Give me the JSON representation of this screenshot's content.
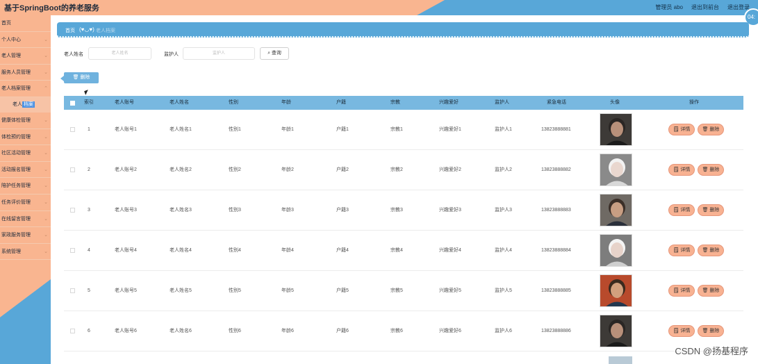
{
  "header": {
    "title": "基于SpringBoot的养老服务",
    "user_label": "管理员 abo",
    "to_front": "退出到前台",
    "logout": "退出登录",
    "clock": "04:"
  },
  "sidebar": {
    "items": [
      {
        "label": "首页",
        "chev": ""
      },
      {
        "label": "个人中心",
        "chev": "⌄"
      },
      {
        "label": "老人管理",
        "chev": "⌄"
      },
      {
        "label": "服务人员管理",
        "chev": "⌄"
      },
      {
        "label": "老人档案管理",
        "chev": "⌃"
      }
    ],
    "sub_label_a": "老人",
    "sub_label_b": "档案",
    "items2": [
      {
        "label": "健康体检管理",
        "chev": "⌄"
      },
      {
        "label": "体检预约管理",
        "chev": "⌄"
      },
      {
        "label": "社区活动管理",
        "chev": "⌄"
      },
      {
        "label": "活动报名管理",
        "chev": "⌄"
      },
      {
        "label": "陪护任务管理",
        "chev": "⌄"
      },
      {
        "label": "任务评价管理",
        "chev": "⌄"
      },
      {
        "label": "在线留言管理",
        "chev": "⌄"
      },
      {
        "label": "家政服务管理",
        "chev": "⌄"
      },
      {
        "label": "系统管理",
        "chev": "⌄"
      }
    ]
  },
  "breadcrumb": {
    "home": "首页",
    "separator": "(♥◡♥)",
    "current": "老人档案"
  },
  "search": {
    "name_label": "老人姓名",
    "name_placeholder": "老人姓名",
    "guardian_label": "监护人",
    "guardian_placeholder": "监护人",
    "button": "⌕ 查询"
  },
  "actions": {
    "delete": "🗑 删除"
  },
  "table": {
    "headers": [
      "索引",
      "老人账号",
      "老人姓名",
      "性别",
      "年龄",
      "户籍",
      "宗教",
      "兴趣爱好",
      "监护人",
      "紧急电话",
      "头像",
      "操作"
    ],
    "detail_label": "🗒 详情",
    "delete_label": "🗑 删除",
    "rows": [
      {
        "index": "1",
        "account": "老人账号1",
        "name": "老人姓名1",
        "gender": "性别1",
        "age": "年龄1",
        "huji": "户籍1",
        "religion": "宗教1",
        "hobby": "兴趣爱好1",
        "guardian": "监护人1",
        "phone": "13823888881"
      },
      {
        "index": "2",
        "account": "老人账号2",
        "name": "老人姓名2",
        "gender": "性别2",
        "age": "年龄2",
        "huji": "户籍2",
        "religion": "宗教2",
        "hobby": "兴趣爱好2",
        "guardian": "监护人2",
        "phone": "13823888882"
      },
      {
        "index": "3",
        "account": "老人账号3",
        "name": "老人姓名3",
        "gender": "性别3",
        "age": "年龄3",
        "huji": "户籍3",
        "religion": "宗教3",
        "hobby": "兴趣爱好3",
        "guardian": "监护人3",
        "phone": "13823888883"
      },
      {
        "index": "4",
        "account": "老人账号4",
        "name": "老人姓名4",
        "gender": "性别4",
        "age": "年龄4",
        "huji": "户籍4",
        "religion": "宗教4",
        "hobby": "兴趣爱好4",
        "guardian": "监护人4",
        "phone": "13823888884"
      },
      {
        "index": "5",
        "account": "老人账号5",
        "name": "老人姓名5",
        "gender": "性别5",
        "age": "年龄5",
        "huji": "户籍5",
        "religion": "宗教5",
        "hobby": "兴趣爱好5",
        "guardian": "监护人5",
        "phone": "13823888885"
      },
      {
        "index": "6",
        "account": "老人账号6",
        "name": "老人姓名6",
        "gender": "性别6",
        "age": "年龄6",
        "huji": "户籍6",
        "religion": "宗教6",
        "hobby": "兴趣爱好6",
        "guardian": "监护人6",
        "phone": "13823888886"
      }
    ]
  },
  "watermark": "CSDN @扬基程序",
  "colors": {
    "peach": "#f9b590",
    "blue": "#58a7d8",
    "table_header": "#78b8e0",
    "button": "#f8b292"
  }
}
